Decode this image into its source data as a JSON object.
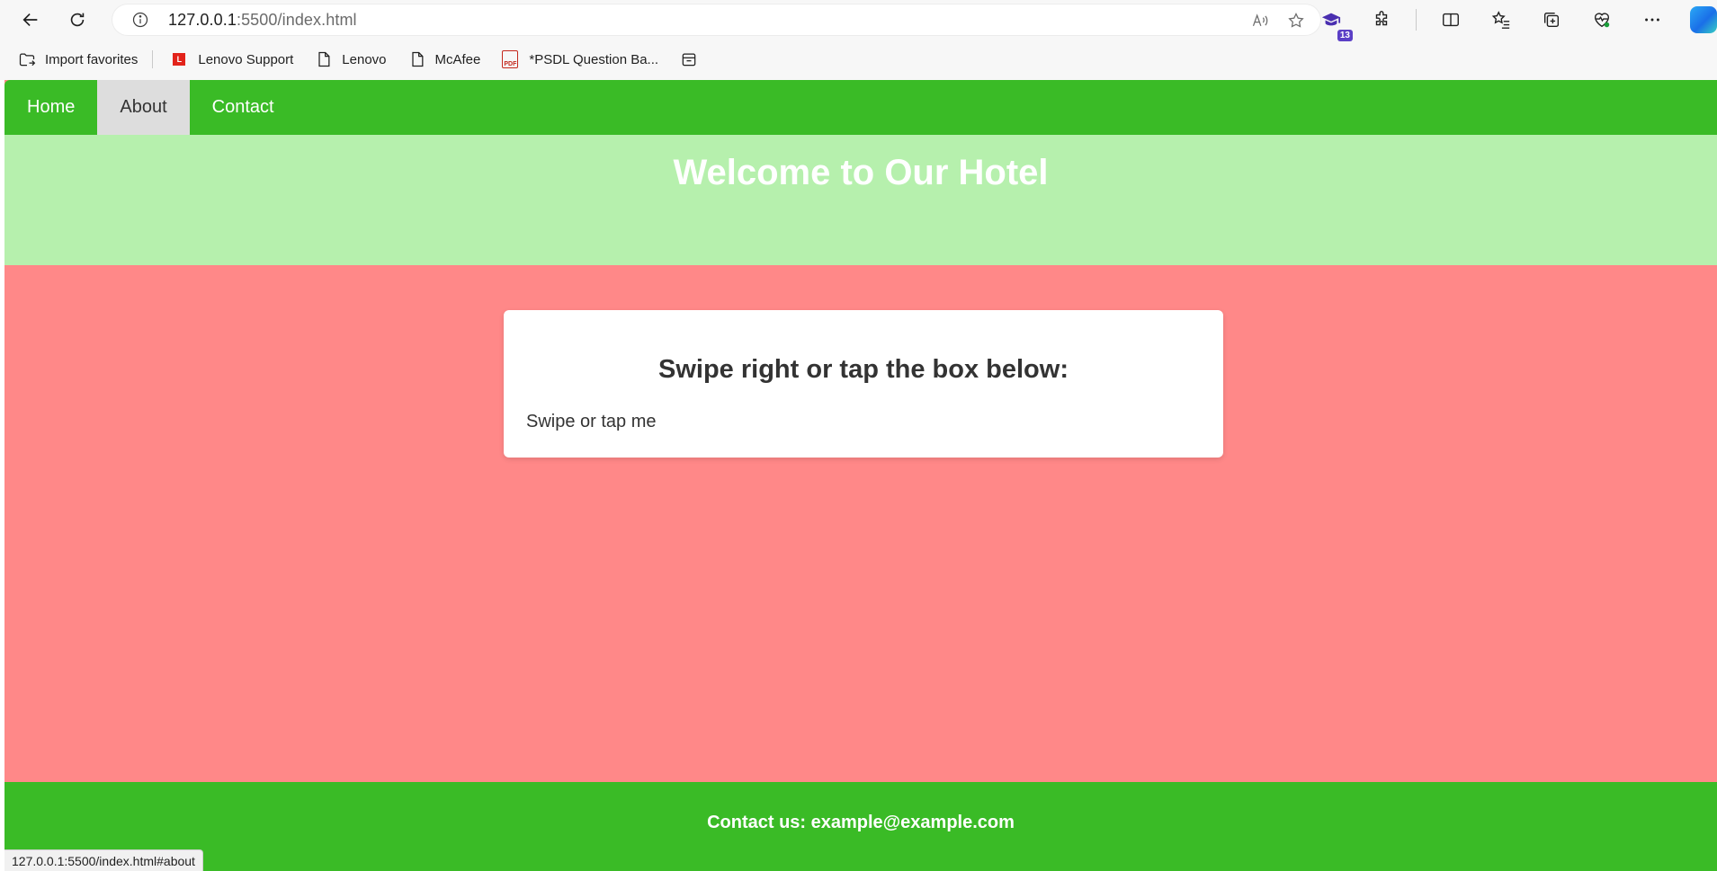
{
  "browser": {
    "url_host": "127.0.0.1",
    "url_rest": ":5500/index.html",
    "extension_badge": "13",
    "bookmarks": [
      {
        "label": "Import favorites",
        "icon": "import-favorites-icon"
      },
      {
        "label": "Lenovo Support",
        "icon": "lenovo-icon"
      },
      {
        "label": "Lenovo",
        "icon": "page-icon"
      },
      {
        "label": "McAfee",
        "icon": "page-icon"
      },
      {
        "label": "*PSDL Question Ba...",
        "icon": "pdf-icon"
      }
    ],
    "lenovo_logo_letter": "L",
    "pdf_logo_text": "PDF",
    "status_url": "127.0.0.1:5500/index.html#about"
  },
  "site": {
    "nav": [
      {
        "label": "Home",
        "active": false
      },
      {
        "label": "About",
        "active": true
      },
      {
        "label": "Contact",
        "active": false
      }
    ],
    "hero_title": "Welcome to Our Hotel",
    "card_title": "Swipe right or tap the box below:",
    "swipe_box_text": "Swipe or tap me",
    "footer_text": "Contact us: example@example.com"
  },
  "colors": {
    "nav_green": "#3abb26",
    "hero_green": "#b6f0ad",
    "body_red": "#ff8888",
    "active_tab": "#dddddd"
  }
}
